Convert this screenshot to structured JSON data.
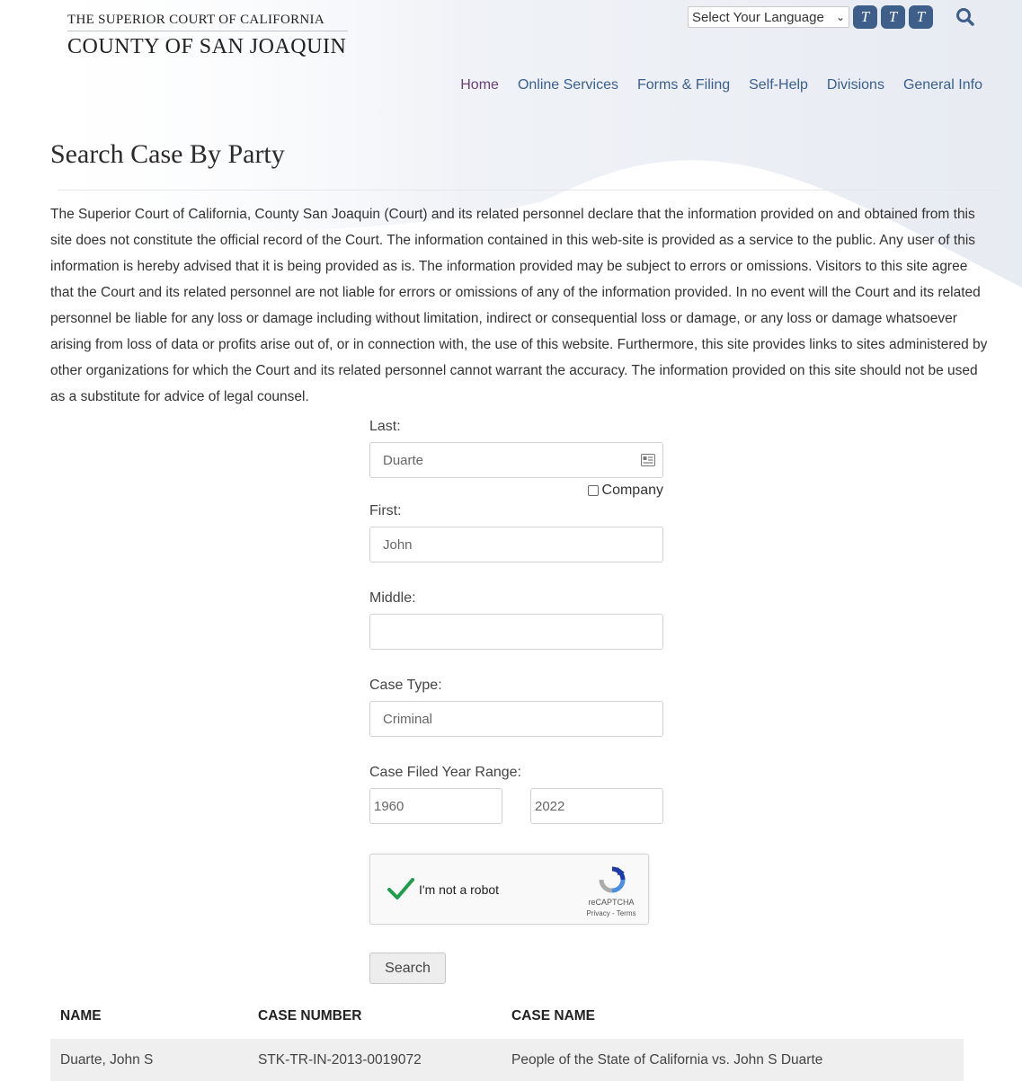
{
  "header": {
    "brand_line1": "THE SUPERIOR COURT OF CALIFORNIA",
    "brand_line2": "COUNTY OF SAN JOAQUIN",
    "language_select": "Select Your Language",
    "text_size_buttons": [
      "T",
      "T",
      "T"
    ],
    "search_icon": "magnifier-icon"
  },
  "nav": {
    "items": [
      "Home",
      "Online Services",
      "Forms & Filing",
      "Self-Help",
      "Divisions",
      "General Info"
    ]
  },
  "page": {
    "title": "Search Case By Party",
    "disclaimer": "The Superior Court of California, County San Joaquin (Court) and its related personnel declare that the information provided on and obtained from this site does not constitute the official record of the Court. The information contained in this web-site is provided as a service to the public. Any user of this information is hereby advised that it is being provided as is. The information provided may be subject to errors or omissions. Visitors to this site agree that the Court and its related personnel are not liable for errors or omissions of any of the information provided. In no event will the Court and its related personnel be liable for any loss or damage including without limitation, indirect or consequential loss or damage, or any loss or damage whatsoever arising from loss of data or profits arise out of, or in connection with, the use of this website. Furthermore, this site provides links to sites administered by other organizations for which the Court and its related personnel cannot warrant the accuracy. The information provided on this site should not be used as a substitute for advice of legal counsel."
  },
  "form": {
    "last_label": "Last:",
    "last_value": "Duarte",
    "company_label": "Company",
    "first_label": "First:",
    "first_value": "John",
    "middle_label": "Middle:",
    "middle_value": "",
    "case_type_label": "Case Type:",
    "case_type_value": "Criminal",
    "year_range_label": "Case Filed Year Range:",
    "year_from": "1960",
    "year_to": "2022",
    "captcha_label": "I'm not a robot",
    "captcha_brand": "reCAPTCHA",
    "captcha_links": "Privacy - Terms",
    "search_button": "Search"
  },
  "results": {
    "headers": [
      "NAME",
      "CASE NUMBER",
      "CASE NAME"
    ],
    "rows": [
      [
        "Duarte, John S",
        "STK-TR-IN-2013-0019072",
        "People of the State of California vs. John S Duarte"
      ]
    ]
  },
  "colors": {
    "accent": "#3e5f8a",
    "nav_link": "#3a5f8f",
    "nav_active": "#6a3f74",
    "captcha_check": "#1e9d4d"
  }
}
